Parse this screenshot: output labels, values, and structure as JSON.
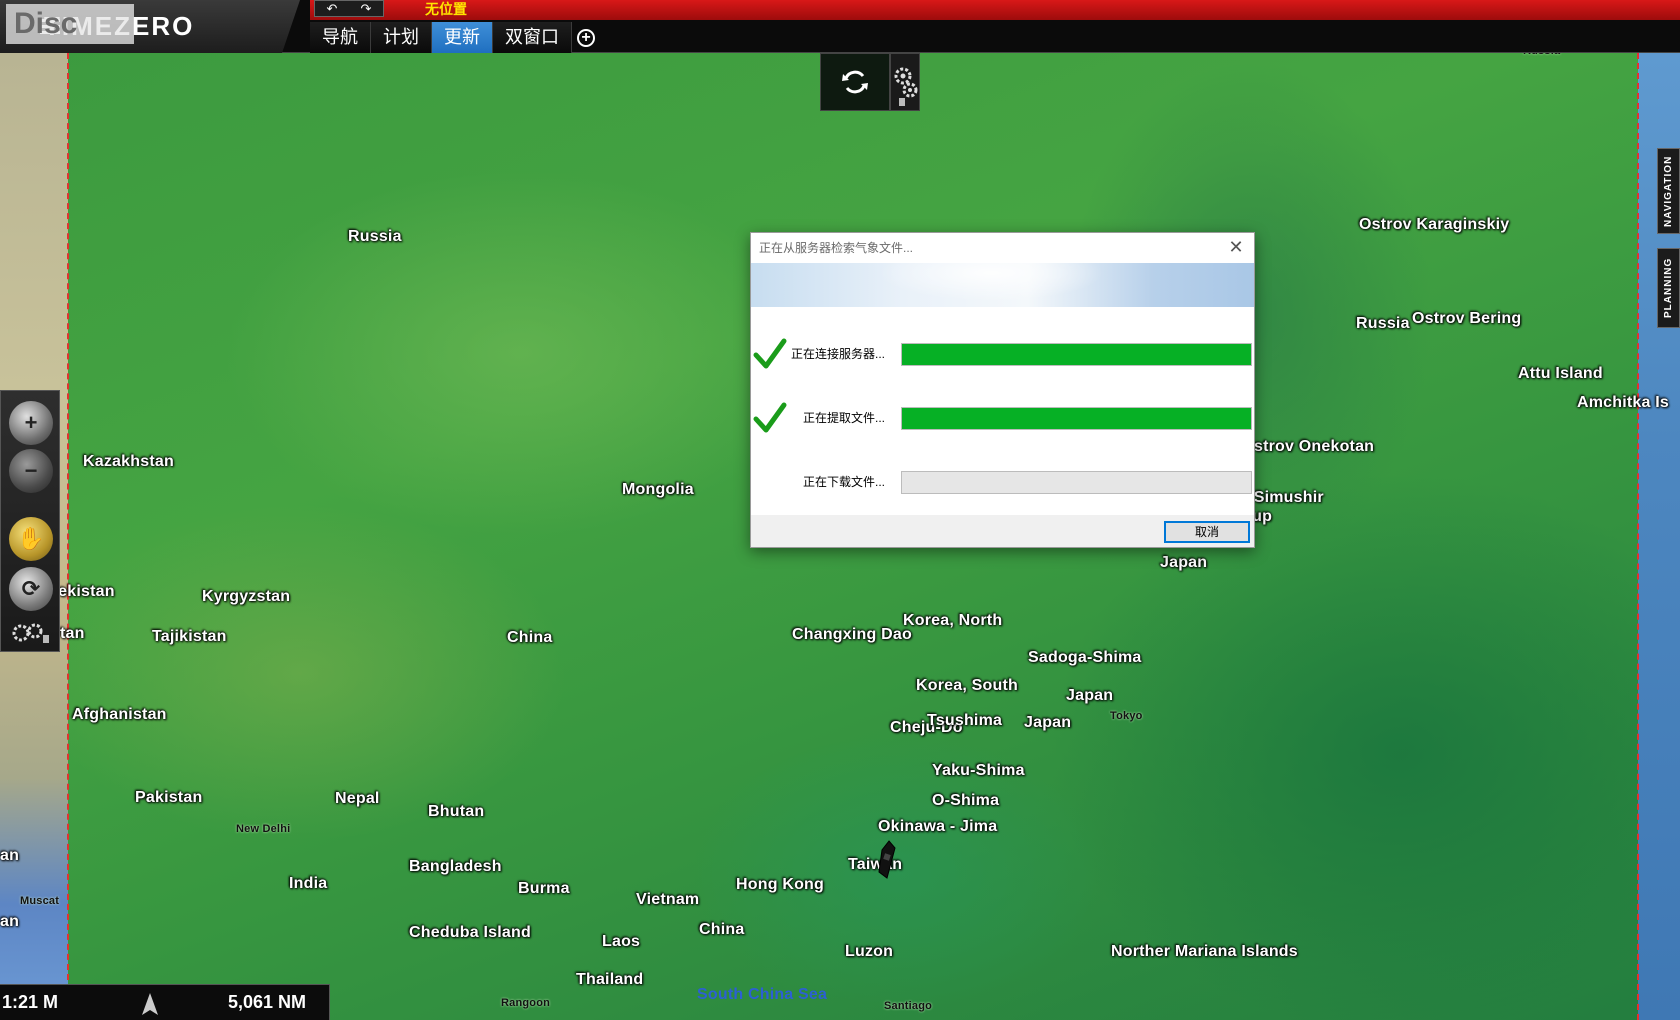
{
  "app": {
    "brand_badge": "Disc",
    "title": "TIMEZERO"
  },
  "toolbar": {
    "undo_label": "↶",
    "redo_label": "↷",
    "position_status": "无位置"
  },
  "tabs": [
    {
      "label": "导航",
      "active": false
    },
    {
      "label": "计划",
      "active": false
    },
    {
      "label": "更新",
      "active": true
    },
    {
      "label": "双窗口",
      "active": false
    }
  ],
  "side_tabs": {
    "navigation": "NAVIGATION",
    "planning": "PLANNING"
  },
  "status": {
    "scale": "1:21 M",
    "distance": "5,061 NM"
  },
  "map_labels": [
    {
      "id": "russia-west",
      "text": "Russia",
      "style": "normal"
    },
    {
      "id": "kazakhstan",
      "text": "Kazakhstan",
      "style": "normal"
    },
    {
      "id": "mongolia",
      "text": "Mongolia",
      "style": "normal"
    },
    {
      "id": "uzbekistan",
      "text": "zbekistan",
      "style": "normal"
    },
    {
      "id": "kyrgyzstan",
      "text": "Kyrgyzstan",
      "style": "normal"
    },
    {
      "id": "turkmenistan-cut",
      "text": "tan",
      "style": "normal"
    },
    {
      "id": "tajikistan",
      "text": "Tajikistan",
      "style": "normal"
    },
    {
      "id": "china-main",
      "text": "China",
      "style": "normal"
    },
    {
      "id": "afghanistan",
      "text": "Afghanistan",
      "style": "normal"
    },
    {
      "id": "pakistan",
      "text": "Pakistan",
      "style": "normal"
    },
    {
      "id": "new-delhi",
      "text": "New Delhi",
      "style": "small"
    },
    {
      "id": "nepal",
      "text": "Nepal",
      "style": "normal"
    },
    {
      "id": "bhutan",
      "text": "Bhutan",
      "style": "normal"
    },
    {
      "id": "iran-cut",
      "text": "an",
      "style": "normal"
    },
    {
      "id": "muscat",
      "text": "Muscat",
      "style": "small"
    },
    {
      "id": "oman-cut",
      "text": "an",
      "style": "normal"
    },
    {
      "id": "india",
      "text": "India",
      "style": "normal"
    },
    {
      "id": "bangladesh",
      "text": "Bangladesh",
      "style": "normal"
    },
    {
      "id": "burma",
      "text": "Burma",
      "style": "normal"
    },
    {
      "id": "vietnam",
      "text": "Vietnam",
      "style": "normal"
    },
    {
      "id": "hong-kong",
      "text": "Hong Kong",
      "style": "normal"
    },
    {
      "id": "china-south",
      "text": "China",
      "style": "normal"
    },
    {
      "id": "cheduba",
      "text": "Cheduba Island",
      "style": "normal"
    },
    {
      "id": "laos",
      "text": "Laos",
      "style": "normal"
    },
    {
      "id": "rangoon",
      "text": "Rangoon",
      "style": "small"
    },
    {
      "id": "thailand",
      "text": "Thailand",
      "style": "normal"
    },
    {
      "id": "south-china-sea",
      "text": "South China Sea",
      "style": "sea"
    },
    {
      "id": "luzon",
      "text": "Luzon",
      "style": "normal"
    },
    {
      "id": "santiago",
      "text": "Santiago",
      "style": "small"
    },
    {
      "id": "taiwan",
      "text": "Taiwan",
      "style": "normal"
    },
    {
      "id": "okinawa",
      "text": "Okinawa - Jima",
      "style": "normal"
    },
    {
      "id": "o-shima",
      "text": "O-Shima",
      "style": "normal"
    },
    {
      "id": "yaku-shima",
      "text": "Yaku-Shima",
      "style": "normal"
    },
    {
      "id": "cheju-do",
      "text": "Cheju-Do",
      "style": "normal"
    },
    {
      "id": "tsushima",
      "text": "Tsushima",
      "style": "normal"
    },
    {
      "id": "japan-south",
      "text": "Japan",
      "style": "normal"
    },
    {
      "id": "japan-mid",
      "text": "Japan",
      "style": "normal"
    },
    {
      "id": "tokyo",
      "text": "Tokyo",
      "style": "small"
    },
    {
      "id": "korea-south",
      "text": "Korea, South",
      "style": "normal"
    },
    {
      "id": "sadoga-shima",
      "text": "Sadoga-Shima",
      "style": "normal"
    },
    {
      "id": "changxing-dao",
      "text": "Changxing Dao",
      "style": "normal"
    },
    {
      "id": "korea-north",
      "text": "Korea, North",
      "style": "normal"
    },
    {
      "id": "japan-north",
      "text": "Japan",
      "style": "normal"
    },
    {
      "id": "urup",
      "text": "Urup",
      "style": "normal"
    },
    {
      "id": "simushir",
      "text": "v Simushir",
      "style": "normal"
    },
    {
      "id": "onekotan",
      "text": "strov Onekotan",
      "style": "normal"
    },
    {
      "id": "amchitka",
      "text": "Amchitka Is",
      "style": "normal"
    },
    {
      "id": "attu",
      "text": "Attu Island",
      "style": "normal"
    },
    {
      "id": "russia-east",
      "text": "Russia",
      "style": "normal"
    },
    {
      "id": "bering",
      "text": "Ostrov Bering",
      "style": "normal"
    },
    {
      "id": "karaginskiy",
      "text": "Ostrov Karaginskiy",
      "style": "normal"
    },
    {
      "id": "northern-mariana",
      "text": "Norther Mariana Islands",
      "style": "normal"
    },
    {
      "id": "russia-top-cut",
      "text": "Russia",
      "style": "small"
    }
  ],
  "dialog": {
    "title": "正在从服务器检索气象文件...",
    "close_label": "✕",
    "steps": [
      {
        "label": "正在连接服务器...",
        "done": true,
        "progress": 1.0
      },
      {
        "label": "正在提取文件...",
        "done": true,
        "progress": 1.0
      },
      {
        "label": "正在下载文件...",
        "done": false,
        "progress": 0.0
      }
    ],
    "cancel_label": "取消"
  },
  "colors": {
    "progress_fill": "#06b025",
    "active_tab": "#2a7fd0",
    "status_bar_red": "#c41414",
    "position_status_text": "#ffe400",
    "boundary_dash": "#e53030"
  }
}
